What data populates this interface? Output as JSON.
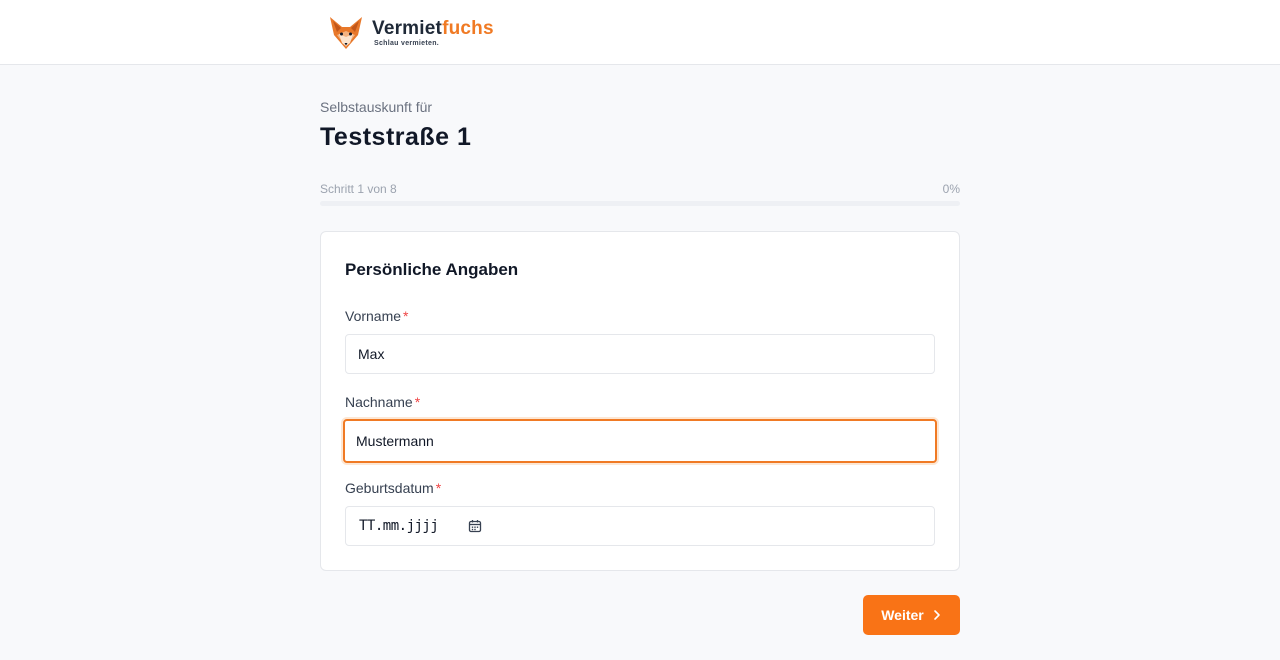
{
  "header": {
    "brand_part1": "Vermiet",
    "brand_part2": "fuchs",
    "tagline": "Schlau vermieten.",
    "logo_icon": "fox-head-icon",
    "accent_color": "#f07a24"
  },
  "page": {
    "subtitle": "Selbstauskunft für",
    "title": "Teststraße 1"
  },
  "progress": {
    "step_text": "Schritt 1 von 8",
    "percent_text": "0%",
    "value": 0
  },
  "form": {
    "section_title": "Persönliche Angaben",
    "required_marker": "*",
    "fields": {
      "vorname": {
        "label": "Vorname",
        "value": "Max"
      },
      "nachname": {
        "label": "Nachname",
        "value": "Mustermann"
      },
      "geburtsdatum": {
        "label": "Geburtsdatum",
        "placeholder": "TT.mm.jjjj",
        "icon": "calendar-icon"
      }
    }
  },
  "actions": {
    "next_label": "Weiter",
    "next_icon": "chevron-right-icon",
    "button_color": "#f97316"
  }
}
